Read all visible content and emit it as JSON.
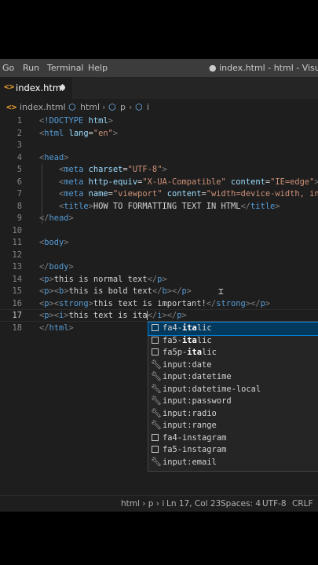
{
  "menu": {
    "items": [
      "Go",
      "Run",
      "Terminal",
      "Help"
    ],
    "window_title": "● index.html - html - Visual Stud"
  },
  "tab": {
    "icon": "<>",
    "label": "index.html"
  },
  "breadcrumb": {
    "file": "index.html",
    "tag1": "html",
    "tag2": "p",
    "tag3": "i"
  },
  "editor": {
    "line_numbers": [
      "1",
      "2",
      "3",
      "4",
      "5",
      "6",
      "7",
      "8",
      "9",
      "10",
      "11",
      "12",
      "13",
      "14",
      "15",
      "16",
      "17",
      "18"
    ],
    "current_line": "17"
  },
  "suggestions": [
    {
      "label": "fa4-italic",
      "kind": "snippet"
    },
    {
      "label": "fa5-italic",
      "kind": "snippet"
    },
    {
      "label": "fa5p-italic",
      "kind": "snippet"
    },
    {
      "label": "input:date",
      "kind": "abbrev"
    },
    {
      "label": "input:datetime",
      "kind": "abbrev"
    },
    {
      "label": "input:datetime-local",
      "kind": "abbrev"
    },
    {
      "label": "input:password",
      "kind": "abbrev"
    },
    {
      "label": "input:radio",
      "kind": "abbrev"
    },
    {
      "label": "input:range",
      "kind": "abbrev"
    },
    {
      "label": "fa4-instagram",
      "kind": "snippet"
    },
    {
      "label": "fa5-instagram",
      "kind": "snippet"
    },
    {
      "label": "input:email",
      "kind": "abbrev"
    }
  ],
  "status": {
    "path": "html › p › i",
    "position": "Ln 17, Col 23",
    "spaces": "Spaces: 4",
    "encoding": "UTF-8",
    "eol": "CRLF"
  }
}
